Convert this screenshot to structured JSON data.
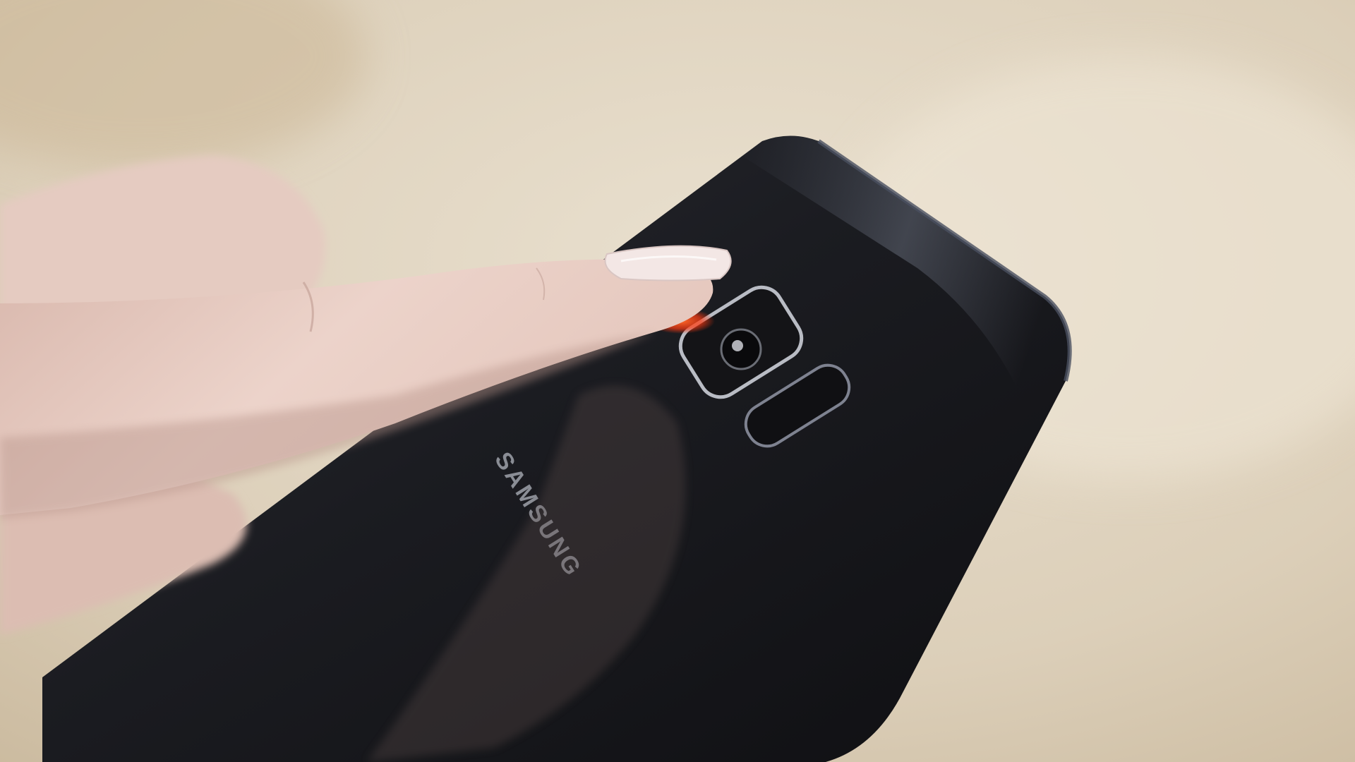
{
  "photo": {
    "brand_label": "SAMSUNG",
    "colors": {
      "background": "#d8cbb4",
      "background_light": "#e6dccb",
      "phone_body": "#1d1d22",
      "phone_edge": "#3a3d48",
      "skin": "#e9cfc6",
      "skin_shadow": "#c9a89f",
      "nail": "#f1e4e2",
      "sensor_glow": "#ff4a1e"
    }
  }
}
